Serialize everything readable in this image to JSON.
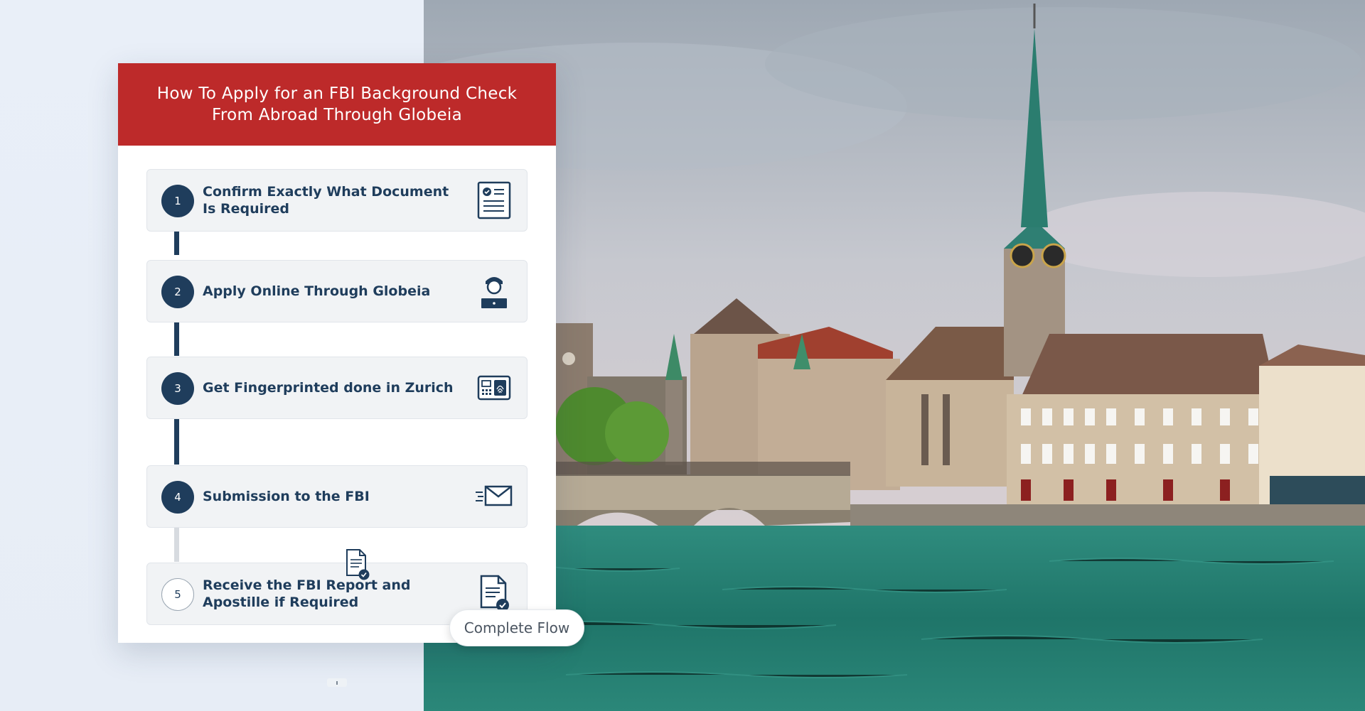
{
  "header": {
    "title": "How To Apply for an FBI Background Check From Abroad Through Globeia"
  },
  "steps": [
    {
      "number": "1",
      "label": "Confirm Exactly What Document Is Required",
      "icon": "document-check-icon",
      "completed": true
    },
    {
      "number": "2",
      "label": "Apply Online Through Globeia",
      "icon": "person-laptop-icon",
      "completed": true
    },
    {
      "number": "3",
      "label": "Get Fingerprinted done in Zurich",
      "icon": "fingerprint-scanner-icon",
      "completed": true
    },
    {
      "number": "4",
      "label": "Submission to the FBI",
      "icon": "fast-mail-icon",
      "completed": true
    },
    {
      "number": "5",
      "label": "Receive the FBI Report and Apostille if Required",
      "icon": "certified-document-icon",
      "completed": false
    }
  ],
  "complete_button": {
    "label": "Complete Flow"
  },
  "colors": {
    "header_red": "#bd2a2a",
    "navy": "#1f3d5c",
    "step_bg": "#f1f3f5",
    "page_bg": "#e8eff8"
  }
}
